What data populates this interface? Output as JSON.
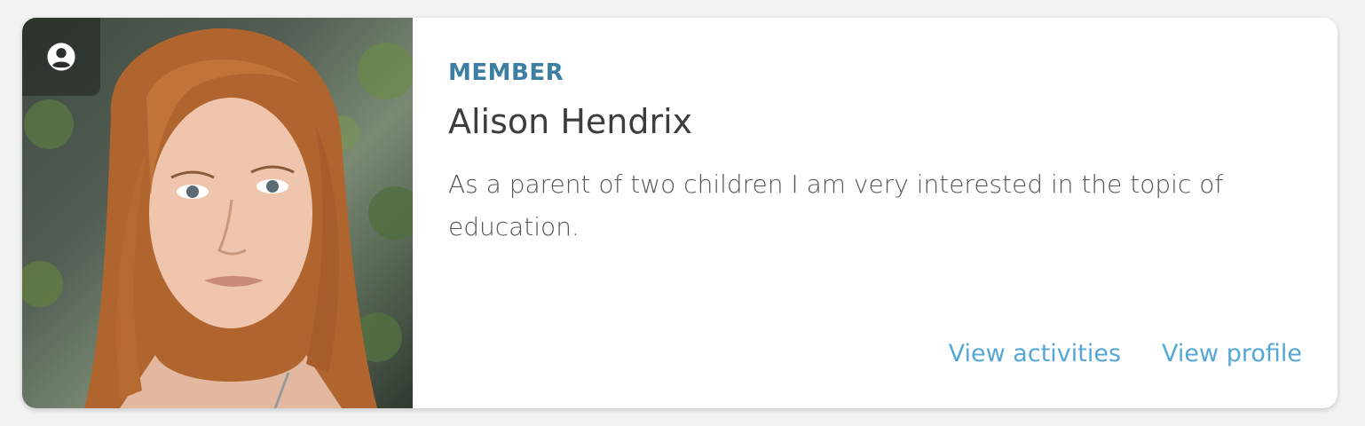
{
  "member_card": {
    "role": "MEMBER",
    "name": "Alison Hendrix",
    "bio": "As a parent of two children I am very interested in the topic of education.",
    "actions": {
      "view_activities": "View activities",
      "view_profile": "View profile"
    },
    "badge_icon": "user-circle-icon",
    "photo_alt": "Alison Hendrix"
  },
  "colors": {
    "role": "#3d7fa3",
    "link": "#55a7d6",
    "name": "#3d3d3d",
    "bio": "#555555"
  }
}
